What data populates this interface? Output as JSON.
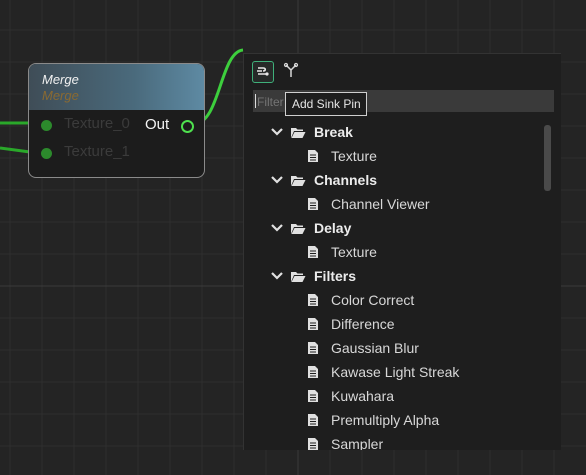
{
  "node": {
    "title": "Merge",
    "subtitle": "Merge",
    "inputs": [
      "Texture_0",
      "Texture_1"
    ],
    "output": "Out"
  },
  "panel": {
    "toolbar": {
      "add_sink_icon": "add-sink-pin-icon",
      "fork_icon": "fork-icon"
    },
    "filter_placeholder": "Filter",
    "tooltip": "Add Sink Pin",
    "tree": [
      {
        "type": "folder",
        "label": "Break"
      },
      {
        "type": "item",
        "label": "Texture"
      },
      {
        "type": "folder",
        "label": "Channels"
      },
      {
        "type": "item",
        "label": "Channel Viewer"
      },
      {
        "type": "folder",
        "label": "Delay"
      },
      {
        "type": "item",
        "label": "Texture"
      },
      {
        "type": "folder",
        "label": "Filters"
      },
      {
        "type": "item",
        "label": "Color Correct"
      },
      {
        "type": "item",
        "label": "Difference"
      },
      {
        "type": "item",
        "label": "Gaussian Blur"
      },
      {
        "type": "item",
        "label": "Kawase Light Streak"
      },
      {
        "type": "item",
        "label": "Kuwahara"
      },
      {
        "type": "item",
        "label": "Premultiply Alpha"
      },
      {
        "type": "item",
        "label": "Sampler"
      }
    ]
  },
  "colors": {
    "accent": "#3fb07a",
    "wire": "#3dcf3d",
    "background": "#242424"
  }
}
